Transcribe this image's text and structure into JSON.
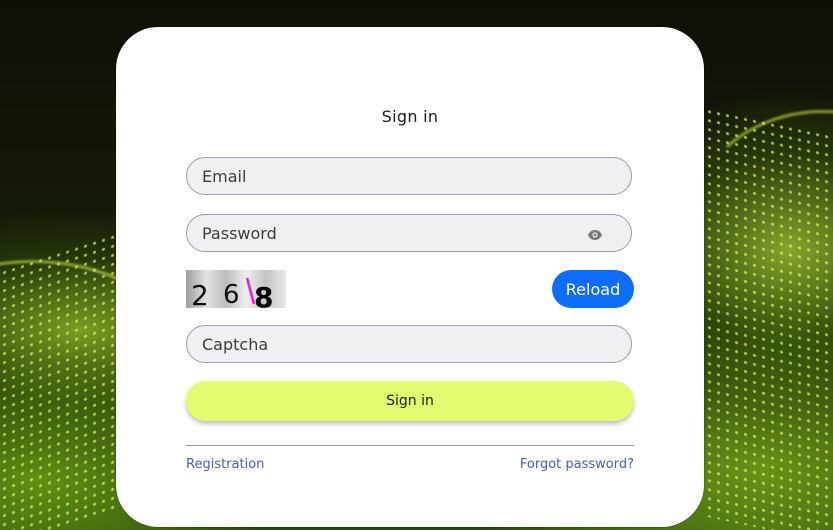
{
  "form": {
    "title": "Sign in",
    "email_placeholder": "Email",
    "password_placeholder": "Password",
    "captcha_text": "268",
    "reload_label": "Reload",
    "captcha_placeholder": "Captcha",
    "submit_label": "Sign in",
    "registration_link": "Registration",
    "forgot_link": "Forgot password?"
  },
  "icons": {
    "password_toggle": "eye-icon"
  },
  "colors": {
    "primary_button": "#0d6efd",
    "submit_button": "#e2fc70",
    "link": "#4d5ea8",
    "background_glow": "#c8ff3c"
  }
}
